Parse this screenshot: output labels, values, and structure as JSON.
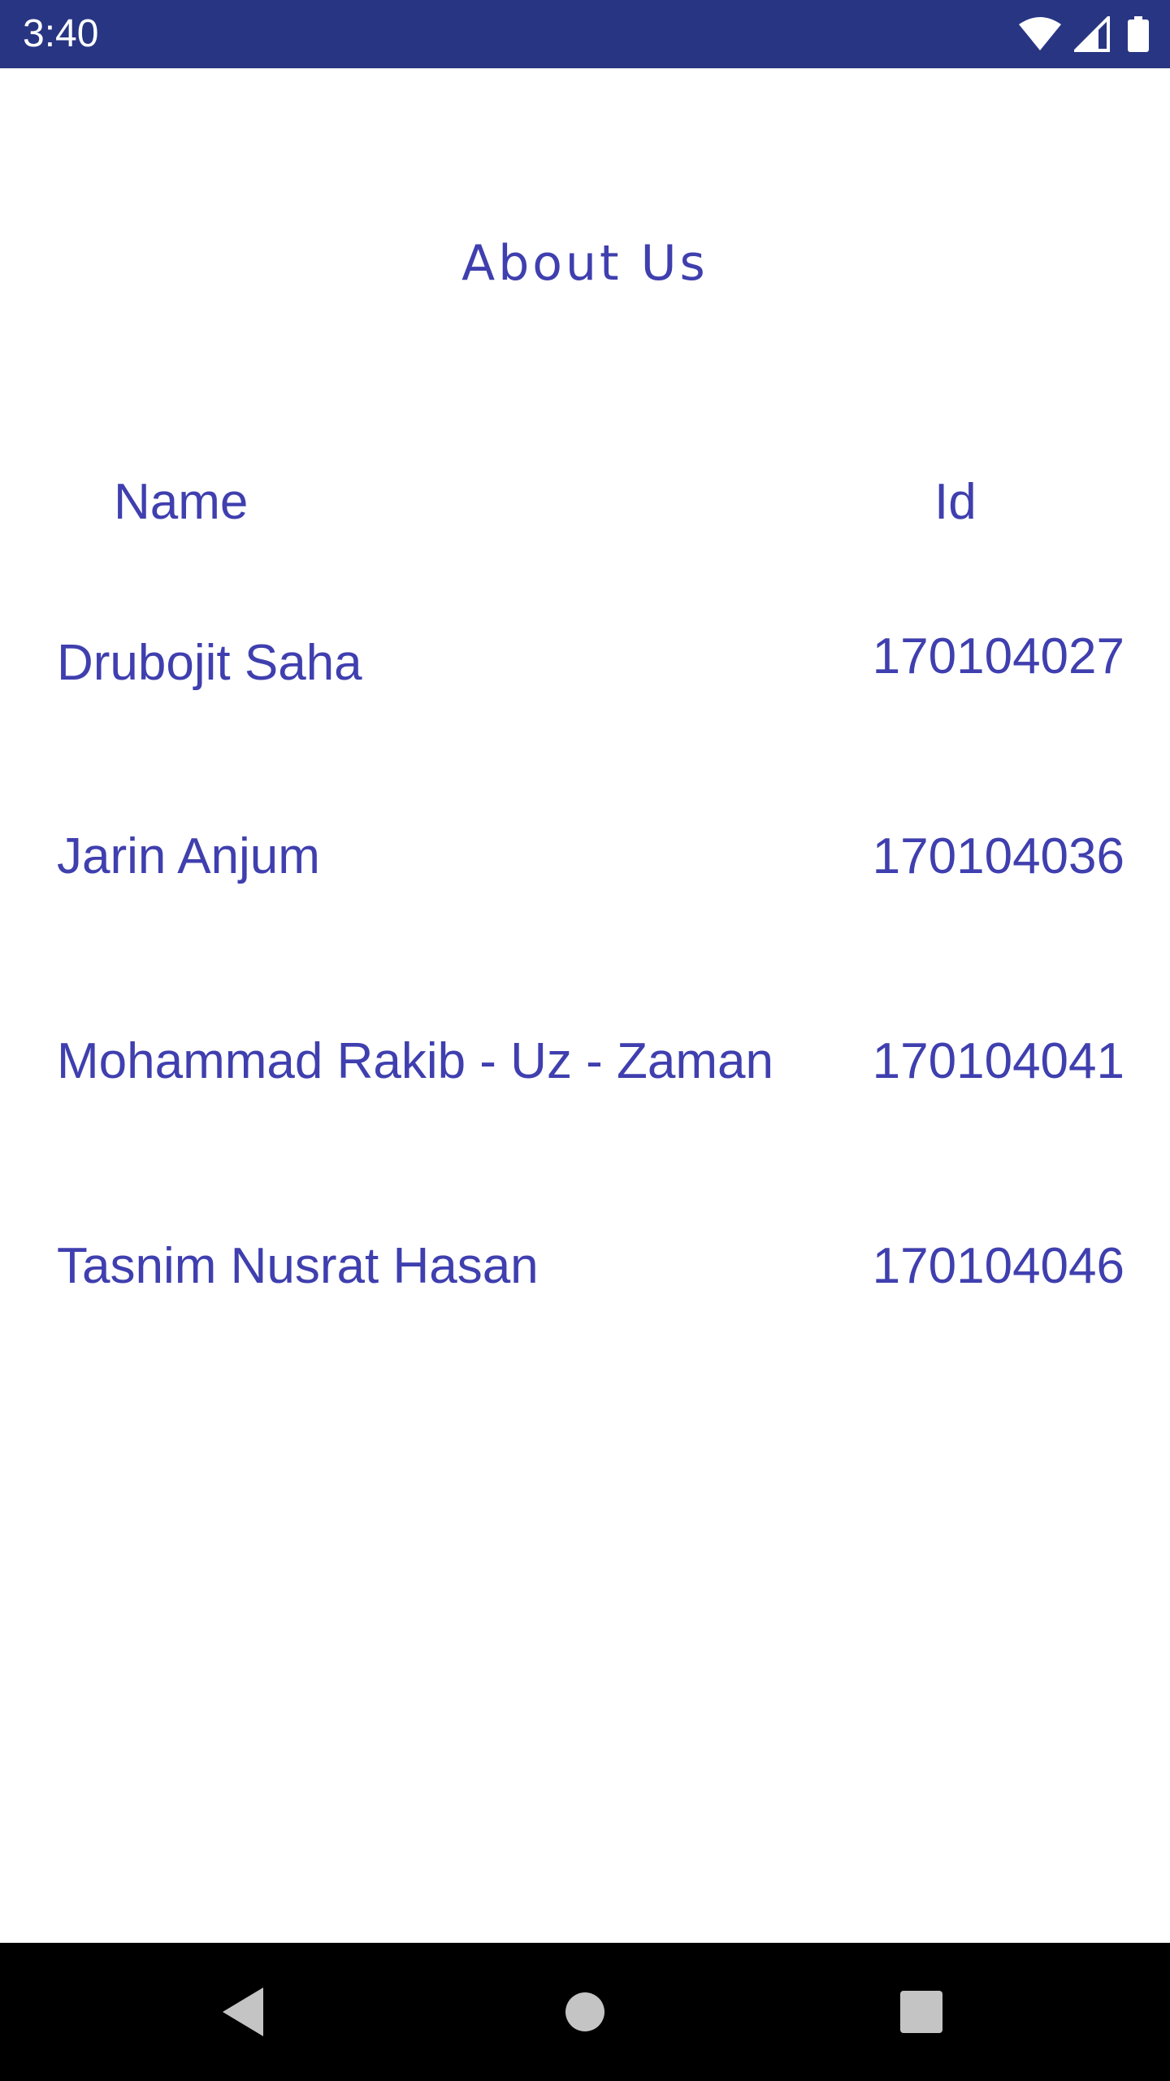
{
  "status_bar": {
    "time": "3:40",
    "icons": [
      "wifi-icon",
      "cellular-signal-icon",
      "battery-icon"
    ],
    "background_color": "#283583"
  },
  "page": {
    "title": "About Us",
    "text_color": "#3f3faf"
  },
  "table": {
    "headers": {
      "name": "Name",
      "id": "Id"
    },
    "rows": [
      {
        "name": "Drubojit Saha",
        "id": "170104027"
      },
      {
        "name": "Jarin Anjum",
        "id": "170104036"
      },
      {
        "name": "Mohammad Rakib - Uz - Zaman",
        "id": "170104041"
      },
      {
        "name": "Tasnim Nusrat Hasan",
        "id": "170104046"
      }
    ]
  },
  "nav_bar": {
    "buttons": [
      "back-icon",
      "home-icon",
      "recents-icon"
    ],
    "background_color": "#000000",
    "icon_color": "#c4c4c4"
  }
}
